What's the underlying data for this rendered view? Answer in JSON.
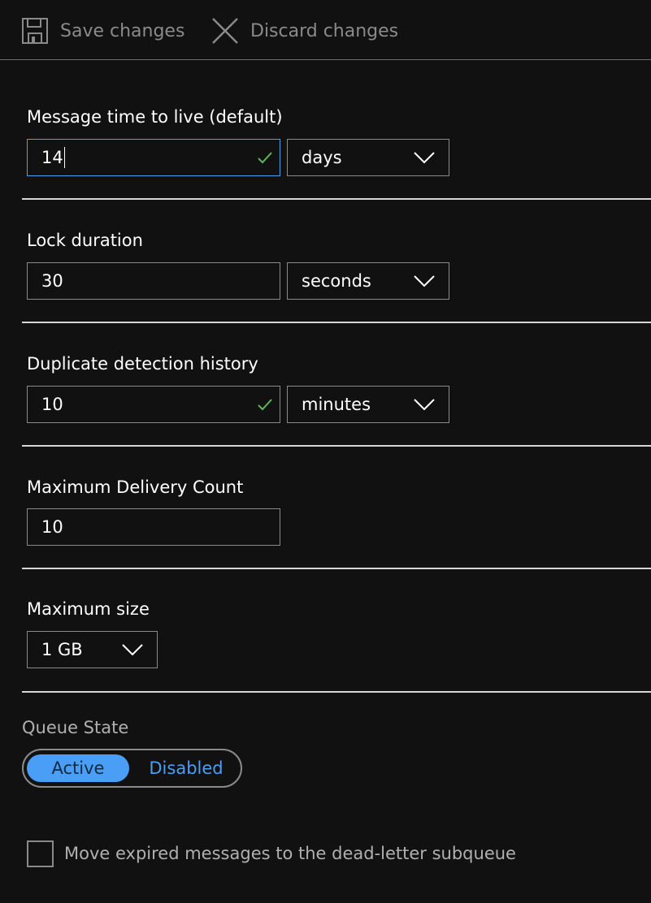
{
  "toolbar": {
    "save_label": "Save changes",
    "discard_label": "Discard changes"
  },
  "message_ttl": {
    "label": "Message time to live (default)",
    "value": "14",
    "unit": "days",
    "valid": true,
    "focused": true
  },
  "lock_duration": {
    "label": "Lock duration",
    "value": "30",
    "unit": "seconds"
  },
  "duplicate_detection": {
    "label": "Duplicate detection history",
    "value": "10",
    "unit": "minutes",
    "valid": true
  },
  "max_delivery": {
    "label": "Maximum Delivery Count",
    "value": "10"
  },
  "max_size": {
    "label": "Maximum size",
    "value": "1 GB"
  },
  "queue_state": {
    "label": "Queue State",
    "options": [
      "Active",
      "Disabled"
    ],
    "selected": "Active"
  },
  "dead_letter": {
    "label": "Move expired messages to the dead-letter subqueue",
    "checked": false
  },
  "colors": {
    "background": "#111111",
    "accent": "#4a9ef5",
    "focus_border": "#4aa3f0",
    "valid_check": "#5cb85c",
    "muted_text": "#8a8a8a"
  },
  "icons": {
    "save": "save-icon",
    "discard": "close-icon",
    "dropdown": "chevron-down-icon",
    "valid": "checkmark-icon"
  }
}
